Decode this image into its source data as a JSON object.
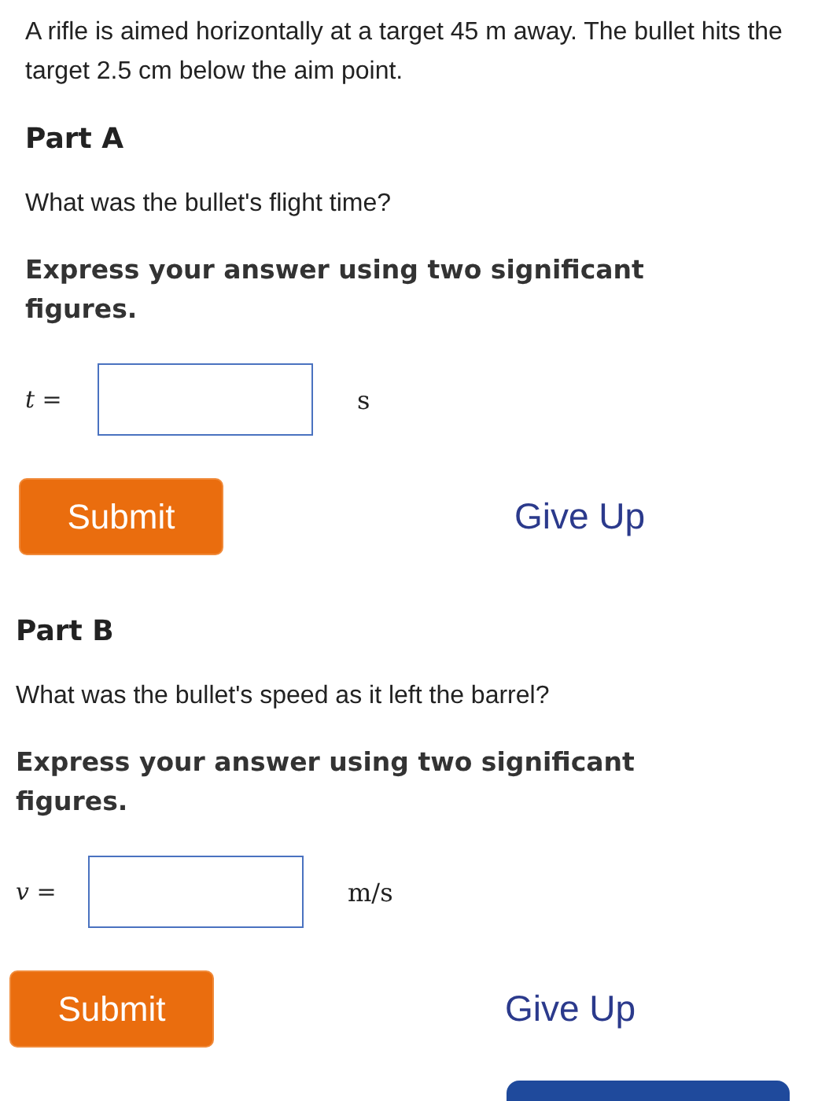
{
  "intro": "A rifle is aimed horizontally at a target 45 m away. The bullet hits the target 2.5 cm below the aim point.",
  "parts": [
    {
      "title": "Part A",
      "question": "What was the bullet's flight time?",
      "instruction": "Express your answer using two significant figures.",
      "label": "*t* =",
      "unit": "s",
      "submit": "Submit",
      "give_up": "Give Up"
    },
    {
      "title": "Part B",
      "question": "What was the bullet's speed as it left the barrel?",
      "instruction": "Express your answer using two significant figures.",
      "label": "*v* =",
      "unit": "m/s",
      "submit": "Submit",
      "give_up": "Give Up"
    }
  ]
}
